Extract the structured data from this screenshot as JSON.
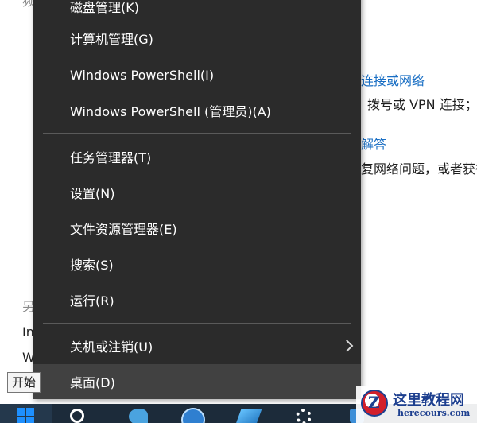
{
  "background": {
    "fragments": {
      "top_left": "频",
      "connect_link": "连接或网络",
      "dial_vpn": "拨号或 VPN 连接；",
      "troubleshoot_link": "解答",
      "network_problem": "复网络问题，或者获得",
      "other_label": "另",
      "item_in": "In",
      "item_w": "W"
    }
  },
  "menu": {
    "items": [
      {
        "label": "磁盘管理(K)"
      },
      {
        "label": "计算机管理(G)"
      },
      {
        "label": "Windows PowerShell(I)"
      },
      {
        "label": "Windows PowerShell (管理员)(A)"
      },
      {
        "label": "任务管理器(T)"
      },
      {
        "label": "设置(N)"
      },
      {
        "label": "文件资源管理器(E)"
      },
      {
        "label": "搜索(S)"
      },
      {
        "label": "运行(R)"
      },
      {
        "label": "关机或注销(U)"
      },
      {
        "label": "桌面(D)"
      }
    ]
  },
  "tooltip": {
    "text": "开始"
  },
  "taskbar": {
    "icons": [
      "windows-logo-icon",
      "cortana-icon",
      "bird-app-icon",
      "sogou-browser-icon",
      "blue-app-icon",
      "settings-gear-icon",
      "edge-icon"
    ]
  },
  "watermark": {
    "logo_letter": "Z",
    "title": "这里教程网",
    "url": "herecours.com"
  },
  "colors": {
    "menu_bg": "#2b2b2b",
    "menu_hover": "#414141",
    "menu_text": "#ffffff",
    "link": "#1a6fc4",
    "taskbar": "#1c2b3a",
    "win_blue": "#1e90ff"
  }
}
